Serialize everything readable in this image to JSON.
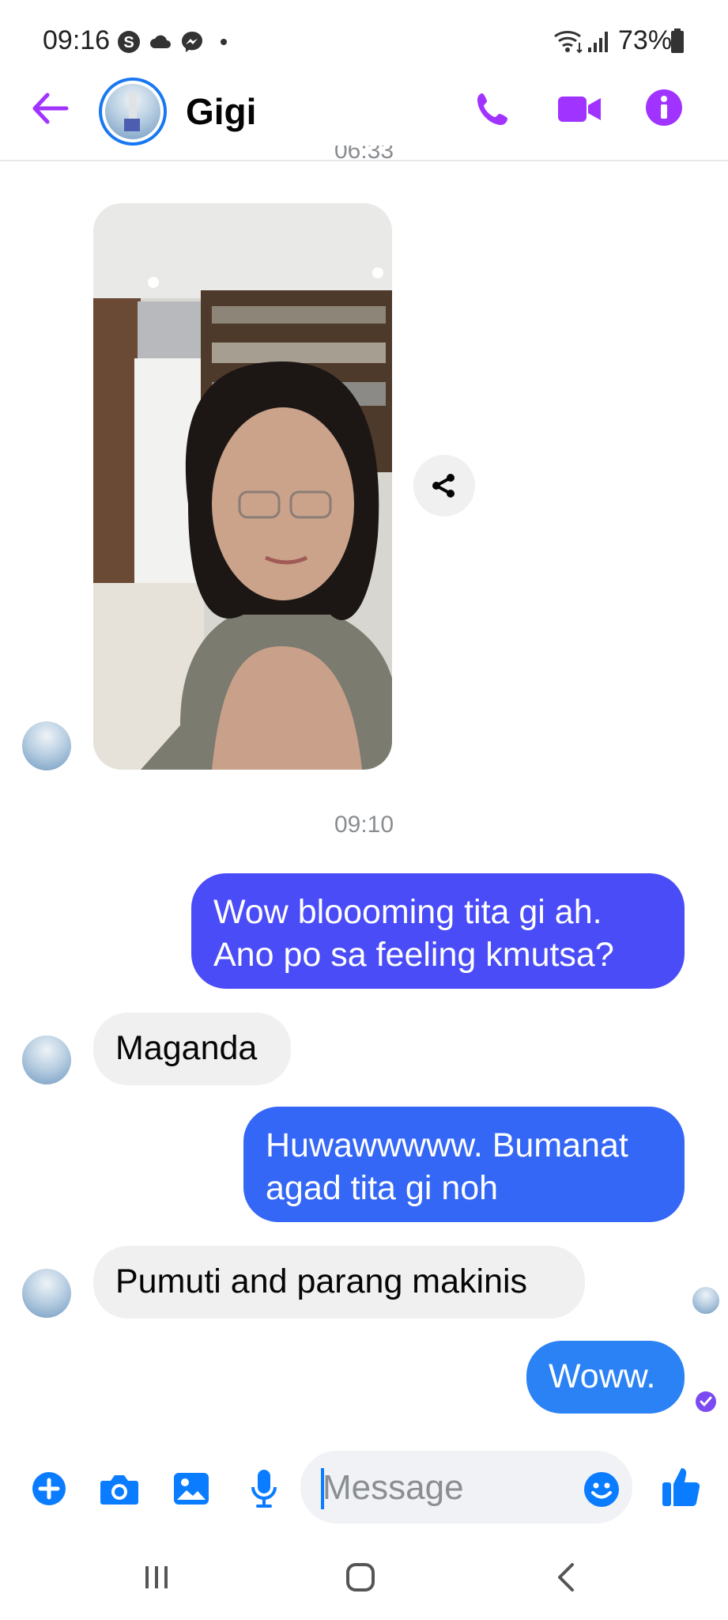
{
  "status_bar": {
    "time": "09:16",
    "battery": "73%",
    "notification_icons": [
      "skype-icon",
      "cloud-icon",
      "messenger-icon",
      "dot-icon"
    ]
  },
  "header": {
    "contact_name": "Gigi",
    "accent_color": "#a033ff"
  },
  "conversation": {
    "prev_timestamp": "06:33",
    "timestamp": "09:10",
    "messages": [
      {
        "from": "me",
        "text": "Wow bloooming tita gi ah.\nAno po sa feeling kmutsa?",
        "color": "#4a4cf7"
      },
      {
        "from": "them",
        "text": "Maganda"
      },
      {
        "from": "me",
        "text": "Huwawwwww. Bumanat\nagad tita gi noh",
        "color": "#3567f6"
      },
      {
        "from": "them",
        "text": "Pumuti and parang makinis"
      },
      {
        "from": "me",
        "text": "Woww.",
        "color": "#2b82f5"
      }
    ]
  },
  "composer": {
    "placeholder": "Message",
    "accent_color": "#0a7cff"
  }
}
